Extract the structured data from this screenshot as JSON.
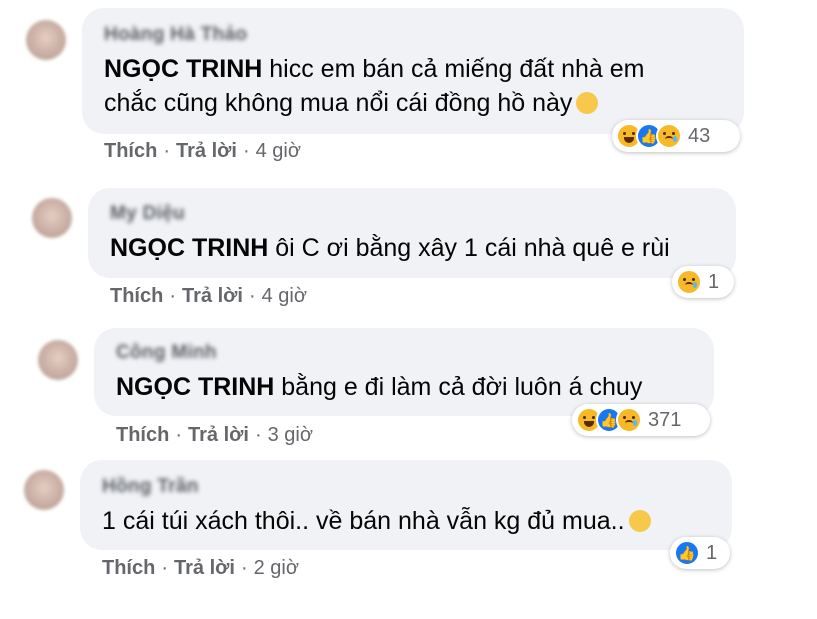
{
  "comments": [
    {
      "author": "Hoàng Hà Thảo",
      "mention": "NGỌC TRINH",
      "line1": " hicc em bán cả miếng đất nhà em",
      "line2": "chắc cũng không mua nổi cái đồng hồ này",
      "like": "Thích",
      "reply": "Trả lời",
      "time": "4 giờ",
      "reaction_count": "43",
      "reaction_icons": [
        "haha-icon",
        "like-icon",
        "sad-icon"
      ]
    },
    {
      "author": "My Diệu",
      "mention": "NGỌC TRINH",
      "line1": " ôi C ơi bằng xây 1 cái nhà quê e rùi",
      "like": "Thích",
      "reply": "Trả lời",
      "time": "4 giờ",
      "reaction_count": "1",
      "reaction_icons": [
        "sad-icon"
      ]
    },
    {
      "author": "Công Minh",
      "mention": "NGỌC TRINH",
      "line1": " bằng e đi làm cả đời luôn á chuy",
      "like": "Thích",
      "reply": "Trả lời",
      "time": "3 giờ",
      "reaction_count": "371",
      "reaction_icons": [
        "haha-icon",
        "like-icon",
        "sad-icon"
      ]
    },
    {
      "author": "Hồng Trần",
      "line1": "1 cái túi xách thôi.. về bán nhà vẫn kg đủ mua..",
      "like": "Thích",
      "reply": "Trả lời",
      "time": "2 giờ",
      "reaction_count": "1",
      "reaction_icons": [
        "like-icon"
      ]
    }
  ],
  "separator": "·",
  "colors": {
    "bubble": "#f0f2f5",
    "meta": "#65676b",
    "like": "#1877f2",
    "emoji": "#f7b928"
  }
}
